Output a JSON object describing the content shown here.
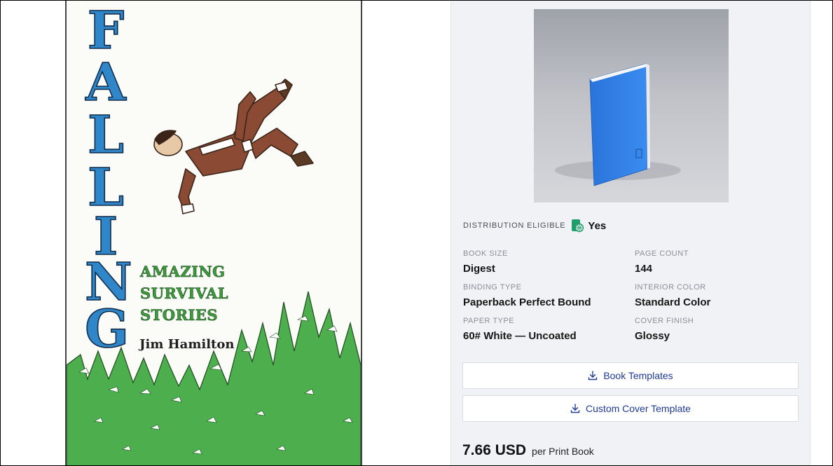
{
  "cover": {
    "title_letters": [
      "F",
      "A",
      "L",
      "L",
      "I",
      "N",
      "G"
    ],
    "subtitle_lines": [
      "AMAZING",
      "SURVIVAL",
      "STORIES"
    ],
    "author": "Jim Hamilton"
  },
  "product": {
    "distribution_label": "DISTRIBUTION ELIGIBLE",
    "distribution_icon": "globe-book-icon",
    "distribution_value": "Yes",
    "specs": {
      "book_size": {
        "label": "BOOK SIZE",
        "value": "Digest"
      },
      "page_count": {
        "label": "PAGE COUNT",
        "value": "144"
      },
      "binding_type": {
        "label": "BINDING TYPE",
        "value": "Paperback Perfect Bound"
      },
      "interior_color": {
        "label": "INTERIOR COLOR",
        "value": "Standard Color"
      },
      "paper_type": {
        "label": "PAPER TYPE",
        "value": "60# White — Uncoated"
      },
      "cover_finish": {
        "label": "COVER FINISH",
        "value": "Glossy"
      }
    },
    "buttons": {
      "book_templates": "Book Templates",
      "custom_cover_template": "Custom Cover Template"
    },
    "price": {
      "amount": "7.66 USD",
      "suffix": "per Print Book"
    }
  },
  "colors": {
    "title_blue": "#2f86c8",
    "subtitle_green": "#3f9a3f",
    "link_blue": "#1f3a93",
    "panel_bg": "#f1f2f6",
    "mockup_book_blue": "#2f7fe6"
  }
}
